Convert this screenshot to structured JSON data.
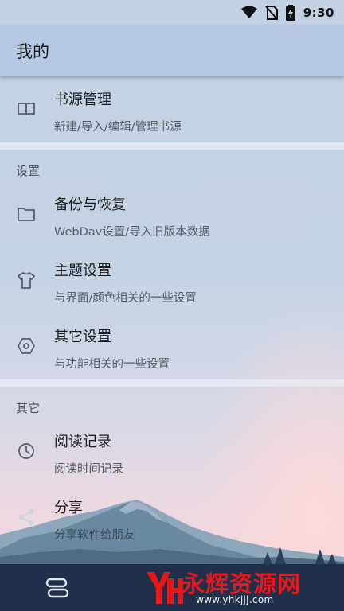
{
  "status_bar": {
    "time": "9:30",
    "icons": [
      "wifi-icon",
      "no-sim-icon",
      "battery-charging-icon"
    ]
  },
  "app_bar": {
    "title": "我的"
  },
  "top_items": [
    {
      "title": "书源管理",
      "subtitle": "新建/导入/编辑/管理书源",
      "icon": "book-icon"
    }
  ],
  "settings_section": {
    "header": "设置",
    "items": [
      {
        "title": "备份与恢复",
        "subtitle": "WebDav设置/导入旧版本数据",
        "icon": "folder-icon"
      },
      {
        "title": "主题设置",
        "subtitle": "与界面/颜色相关的一些设置",
        "icon": "tshirt-icon"
      },
      {
        "title": "其它设置",
        "subtitle": "与功能相关的一些设置",
        "icon": "hexagon-gear-icon"
      }
    ]
  },
  "other_section": {
    "header": "其它",
    "items": [
      {
        "title": "阅读记录",
        "subtitle": "阅读时间记录",
        "icon": "clock-icon"
      },
      {
        "title": "分享",
        "subtitle": "分享软件给朋友",
        "icon": "share-icon"
      }
    ]
  },
  "bottom_nav": {
    "icon": "menu-toggle-icon"
  },
  "watermark": {
    "brand": "永辉资源网",
    "url": "www.yhkjjj.com",
    "logo": "yh-logo"
  },
  "colors": {
    "app_bar": "#b7c8e2",
    "background_top": "#c3d0e2",
    "sky_bottom": "#f2d6dc",
    "mountain": "#5d7c93",
    "nav_bar": "#20304a",
    "watermark_red": "#e8171a"
  }
}
